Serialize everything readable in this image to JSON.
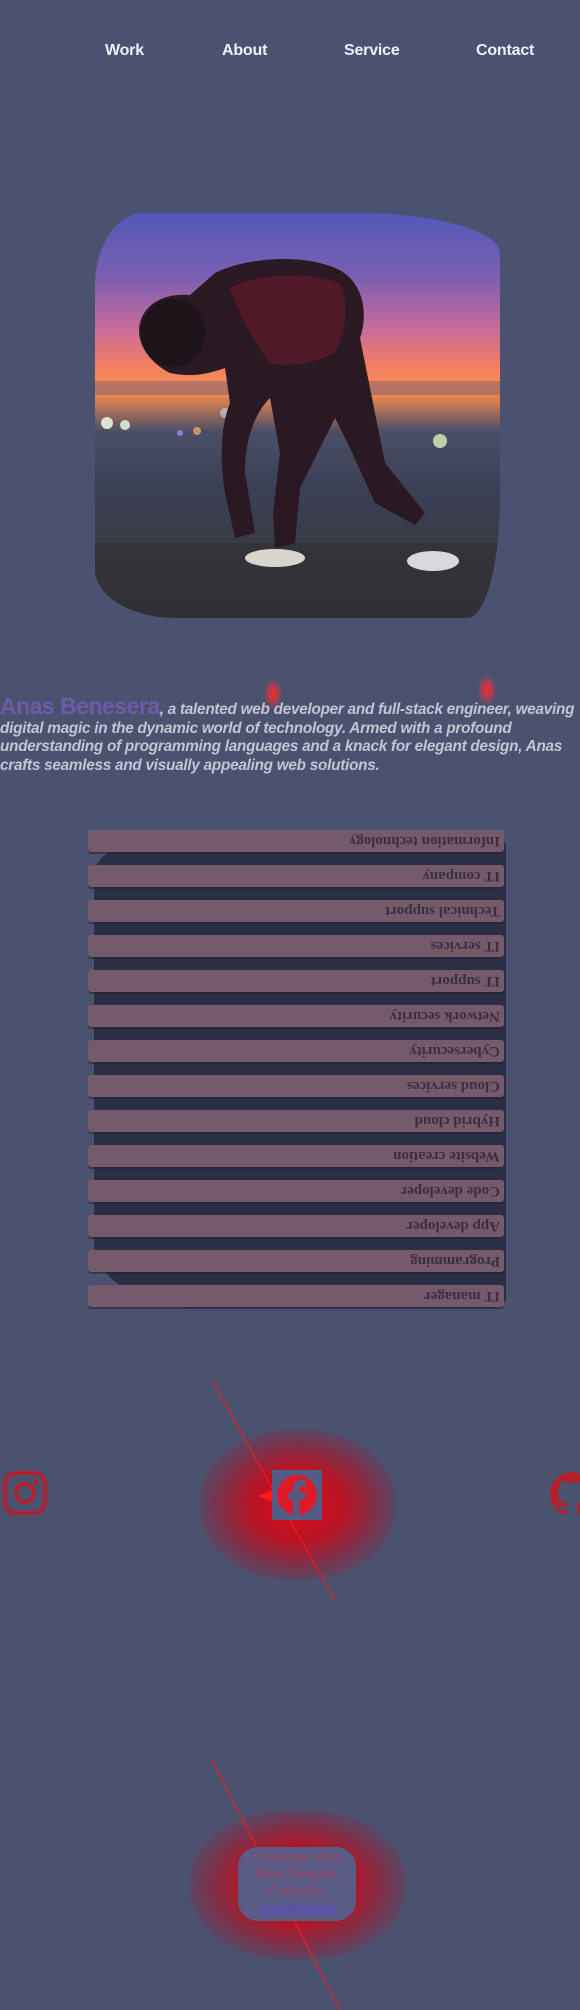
{
  "nav": {
    "items": [
      {
        "label": "Work"
      },
      {
        "label": "About"
      },
      {
        "label": "Service"
      },
      {
        "label": "Contact"
      }
    ]
  },
  "hero": {
    "image_alt": "Person tying shoes at sunset"
  },
  "bio": {
    "name": "Anas Benesera",
    "text": ", a talented web developer and full-stack engineer, weaving digital magic in the dynamic world of technology. Armed with a profound understanding of programming languages and a knack for elegant design, Anas crafts seamless and visually appealing web solutions."
  },
  "skills": [
    "Information technology",
    "IT company",
    "Technical support",
    "IT services",
    "IT support",
    "Network security",
    "Cybersecurity",
    "Cloud services",
    "Hybrid cloud",
    "Website creation",
    "Code developer",
    "App developer",
    "Programming",
    "IT manager"
  ],
  "social": {
    "icons": [
      "instagram-icon",
      "facebook-icon",
      "github-icon"
    ],
    "accent": "#dc0a19"
  },
  "footer": {
    "line1": "Challenge Main",
    "line2": "Html Template",
    "line3": "Coded by",
    "author": "Anasbenesera"
  },
  "colors": {
    "background": "#4b5270",
    "nav_text": "#eef0f8",
    "name": "#6b5ba8",
    "bio_text": "#c4c5d4",
    "skill_row": "#755a6c",
    "footer_pill": "#5a5c86"
  }
}
